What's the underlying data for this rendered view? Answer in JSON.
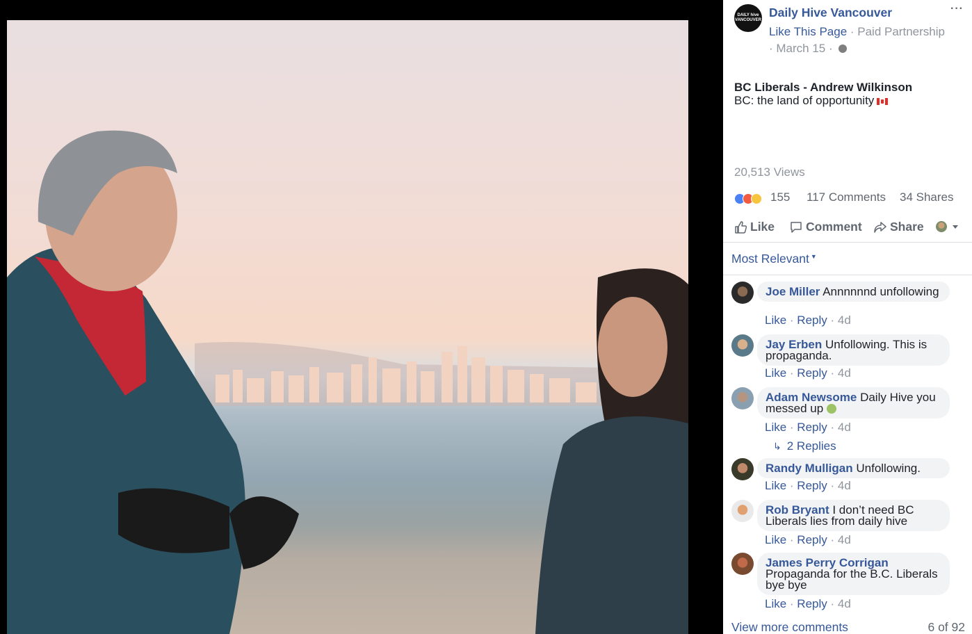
{
  "page": {
    "name": "Daily Hive Vancouver",
    "avatar_text_1": "DAILY hive",
    "avatar_text_2": "VANCOUVER",
    "like_page": "Like This Page",
    "meta_sep1": " · ",
    "meta_tag": "Paid Partnership",
    "meta_sep2": " · ",
    "date": "March 15",
    "meta_sep3": " · "
  },
  "post": {
    "title": "BC Liberals - Andrew Wilkinson",
    "text": "BC: the land of opportunity",
    "views": "20,513 Views",
    "reactions_count": "155",
    "comments_count": "117 Comments",
    "shares_count": "34 Shares"
  },
  "actions": {
    "like": "Like",
    "comment": "Comment",
    "share": "Share"
  },
  "sort_label": "Most Relevant",
  "comments": [
    {
      "name": "Joe Miller",
      "text": "Annnnnnd unfollowing",
      "like": "Like",
      "reply": "Reply",
      "age": "4d"
    },
    {
      "name": "Jay Erben",
      "text": "Unfollowing. This is propaganda.",
      "like": "Like",
      "reply": "Reply",
      "age": "4d"
    },
    {
      "name": "Adam Newsome",
      "text": "Daily Hive you messed up",
      "like": "Like",
      "reply": "Reply",
      "age": "4d",
      "replies": "2 Replies"
    },
    {
      "name": "Randy Mulligan",
      "text": "Unfollowing.",
      "like": "Like",
      "reply": "Reply",
      "age": "4d"
    },
    {
      "name": "Rob Bryant",
      "text": "I don’t need BC Liberals lies from daily hive",
      "like": "Like",
      "reply": "Reply",
      "age": "4d"
    },
    {
      "name": "James Perry Corrigan",
      "text": "Propaganda for the B.C. Liberals bye bye",
      "like": "Like",
      "reply": "Reply",
      "age": "4d"
    }
  ],
  "separators": {
    "dot": " · "
  },
  "footer": {
    "view_more": "View more comments",
    "count": "6 of 92"
  },
  "colors": {
    "link": "#365899",
    "muted": "#90949c",
    "bubble": "#f2f3f5"
  }
}
